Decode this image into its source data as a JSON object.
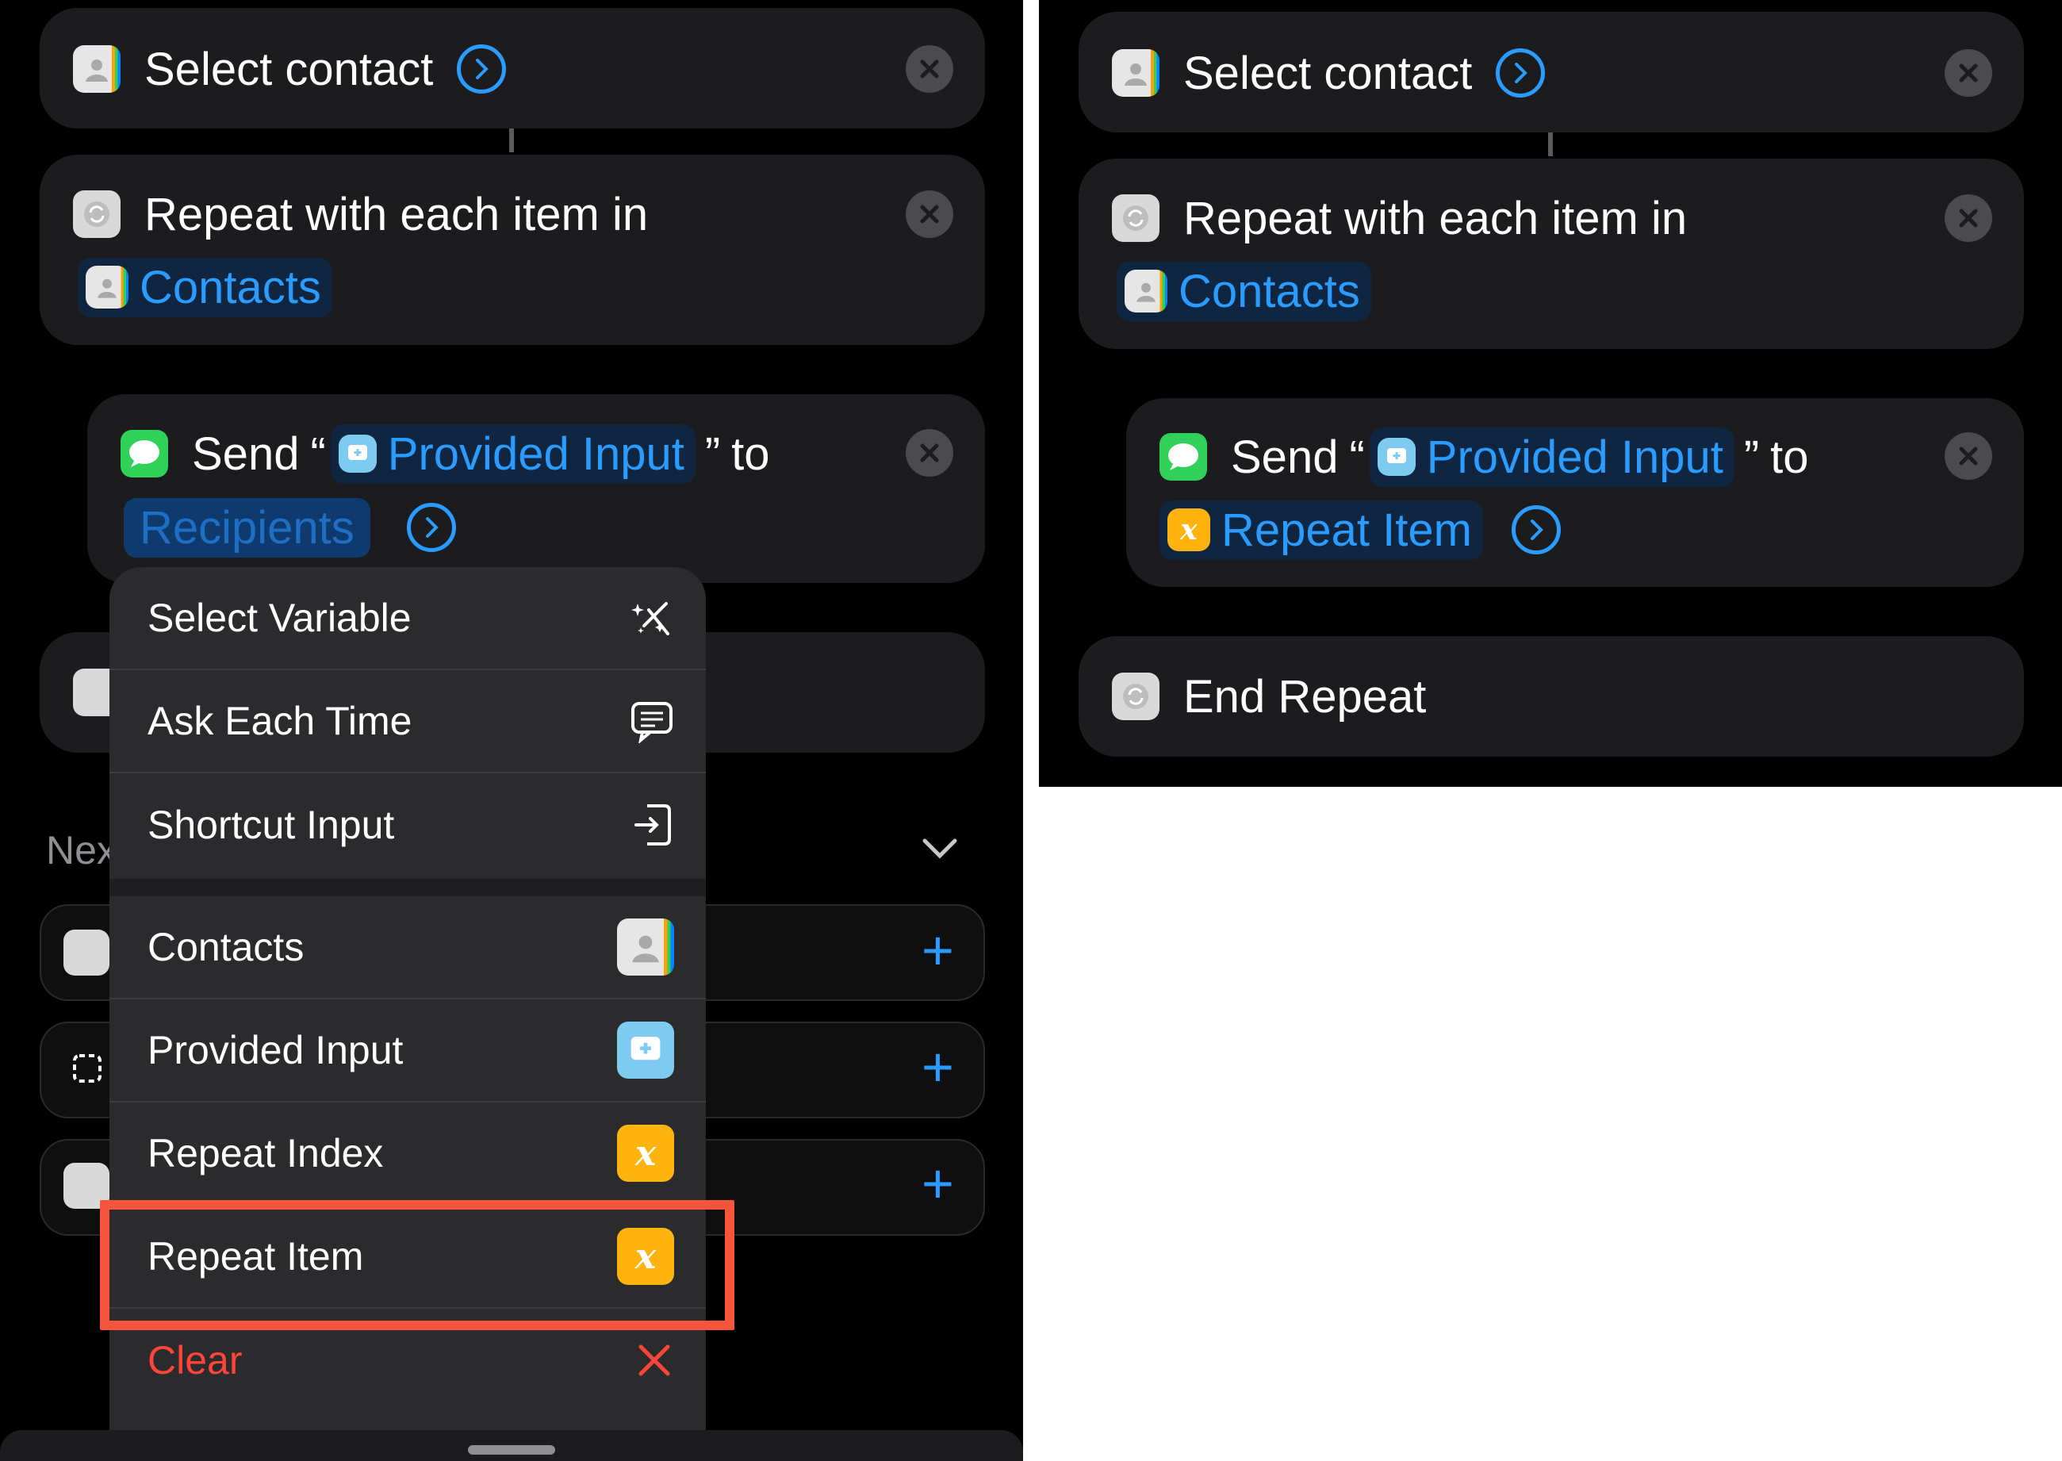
{
  "left": {
    "select_contact": {
      "label": "Select contact"
    },
    "repeat": {
      "line1": "Repeat with each item in",
      "variable": "Contacts"
    },
    "send": {
      "word": "Send",
      "open_quote": "“",
      "input": "Provided Input",
      "close_quote": "”",
      "to": "to",
      "recipients": "Recipients"
    },
    "next_header": "Nex",
    "menu": {
      "items": [
        {
          "label": "Select Variable",
          "icon": "magic-wand-icon"
        },
        {
          "label": "Ask Each Time",
          "icon": "chat-bubble-icon"
        },
        {
          "label": "Shortcut Input",
          "icon": "shortcut-input-icon"
        },
        {
          "label": "Contacts",
          "icon": "contacts-app-icon"
        },
        {
          "label": "Provided Input",
          "icon": "provided-input-icon"
        },
        {
          "label": "Repeat Index",
          "icon": "variable-icon"
        },
        {
          "label": "Repeat Item",
          "icon": "variable-icon"
        }
      ],
      "clear": "Clear",
      "highlighted_item": "Repeat Item",
      "variable_glyph": "x"
    }
  },
  "right": {
    "select_contact": {
      "label": "Select contact"
    },
    "repeat": {
      "line1": "Repeat with each item in",
      "variable": "Contacts"
    },
    "send": {
      "word": "Send",
      "open_quote": "“",
      "input": "Provided Input",
      "close_quote": "”",
      "to": "to",
      "recipient": "Repeat Item"
    },
    "end_repeat": "End Repeat",
    "variable_glyph": "x"
  },
  "colors": {
    "accent": "#2a9cff",
    "highlight": "#f4553b",
    "destructive": "#ff453a",
    "variable": "#ffb30f",
    "card": "#1c1c1e",
    "menu": "#2b2b2e"
  }
}
